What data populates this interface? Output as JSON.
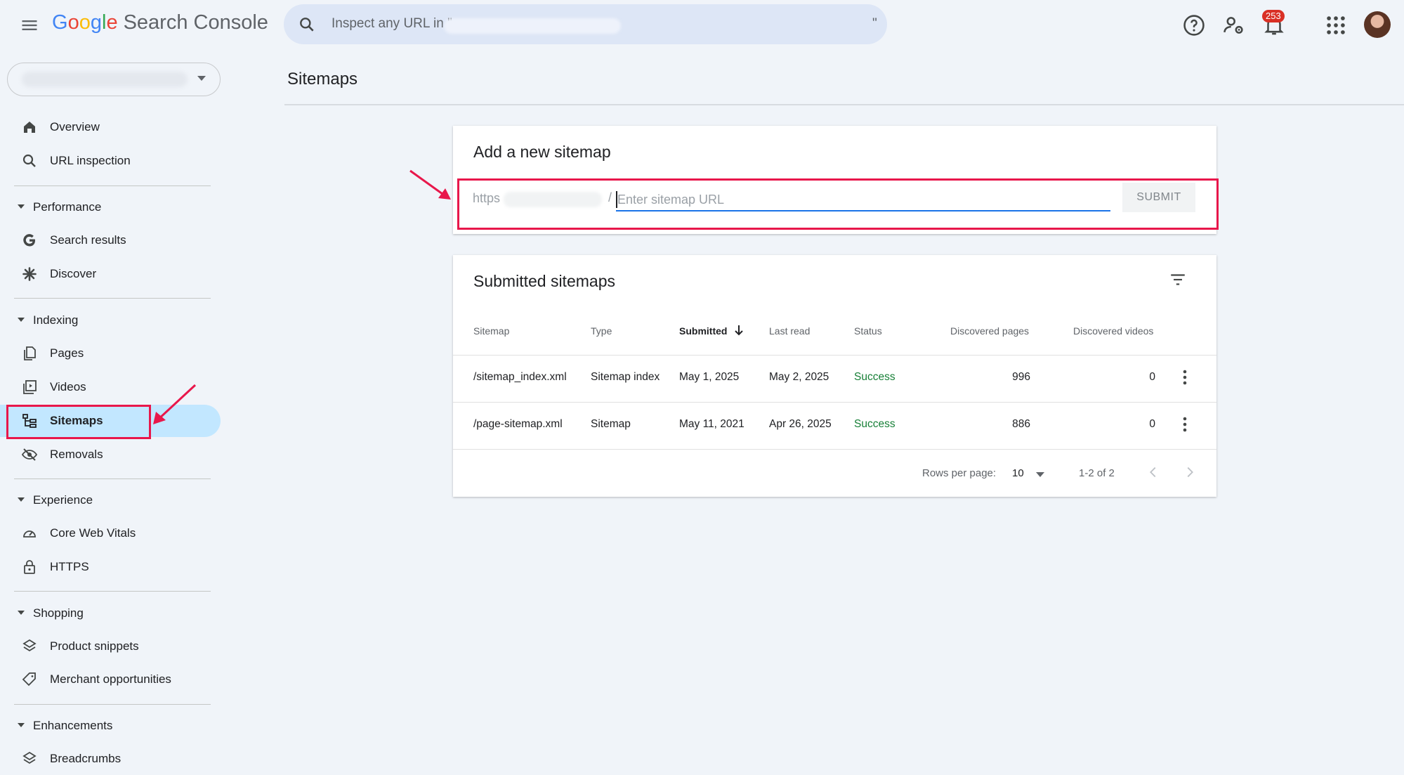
{
  "header": {
    "app_title_google": "Google",
    "app_title_rest": "Search Console",
    "search_placeholder": "Inspect any URL in \"",
    "search_placeholder_end": "\"",
    "notification_count": "253"
  },
  "sidebar": {
    "items": [
      {
        "label": "Overview",
        "icon": "home-icon"
      },
      {
        "label": "URL inspection",
        "icon": "search-icon"
      }
    ],
    "sections": [
      {
        "label": "Performance",
        "items": [
          {
            "label": "Search results",
            "icon": "google-g-icon"
          },
          {
            "label": "Discover",
            "icon": "asterisk-icon"
          }
        ]
      },
      {
        "label": "Indexing",
        "items": [
          {
            "label": "Pages",
            "icon": "pages-icon"
          },
          {
            "label": "Videos",
            "icon": "video-icon"
          },
          {
            "label": "Sitemaps",
            "icon": "sitemap-icon"
          },
          {
            "label": "Removals",
            "icon": "eye-off-icon"
          }
        ]
      },
      {
        "label": "Experience",
        "items": [
          {
            "label": "Core Web Vitals",
            "icon": "gauge-icon"
          },
          {
            "label": "HTTPS",
            "icon": "lock-icon"
          }
        ]
      },
      {
        "label": "Shopping",
        "items": [
          {
            "label": "Product snippets",
            "icon": "layers-icon"
          },
          {
            "label": "Merchant opportunities",
            "icon": "tag-icon"
          }
        ]
      },
      {
        "label": "Enhancements",
        "items": [
          {
            "label": "Breadcrumbs",
            "icon": "layers-icon"
          }
        ]
      }
    ]
  },
  "main": {
    "page_title": "Sitemaps",
    "add_card": {
      "title": "Add a new sitemap",
      "prefix": "https",
      "slash": "/",
      "input_placeholder": "Enter sitemap URL",
      "submit_label": "SUBMIT"
    },
    "submitted_card": {
      "title": "Submitted sitemaps",
      "columns": [
        "Sitemap",
        "Type",
        "Submitted",
        "Last read",
        "Status",
        "Discovered pages",
        "Discovered videos"
      ],
      "rows": [
        {
          "sitemap": "/sitemap_index.xml",
          "type": "Sitemap index",
          "submitted": "May 1, 2025",
          "last_read": "May 2, 2025",
          "status": "Success",
          "pages": "996",
          "videos": "0"
        },
        {
          "sitemap": "/page-sitemap.xml",
          "type": "Sitemap",
          "submitted": "May 11, 2021",
          "last_read": "Apr 26, 2025",
          "status": "Success",
          "pages": "886",
          "videos": "0"
        }
      ],
      "rows_per_page_label": "Rows per page:",
      "rows_per_page_value": "10",
      "range_label": "1-2 of 2"
    }
  },
  "colors": {
    "accent": "#1a73e8",
    "active_nav": "#c2e7ff",
    "success": "#188038",
    "highlight": "#e8174b",
    "background": "#f0f4f9"
  }
}
